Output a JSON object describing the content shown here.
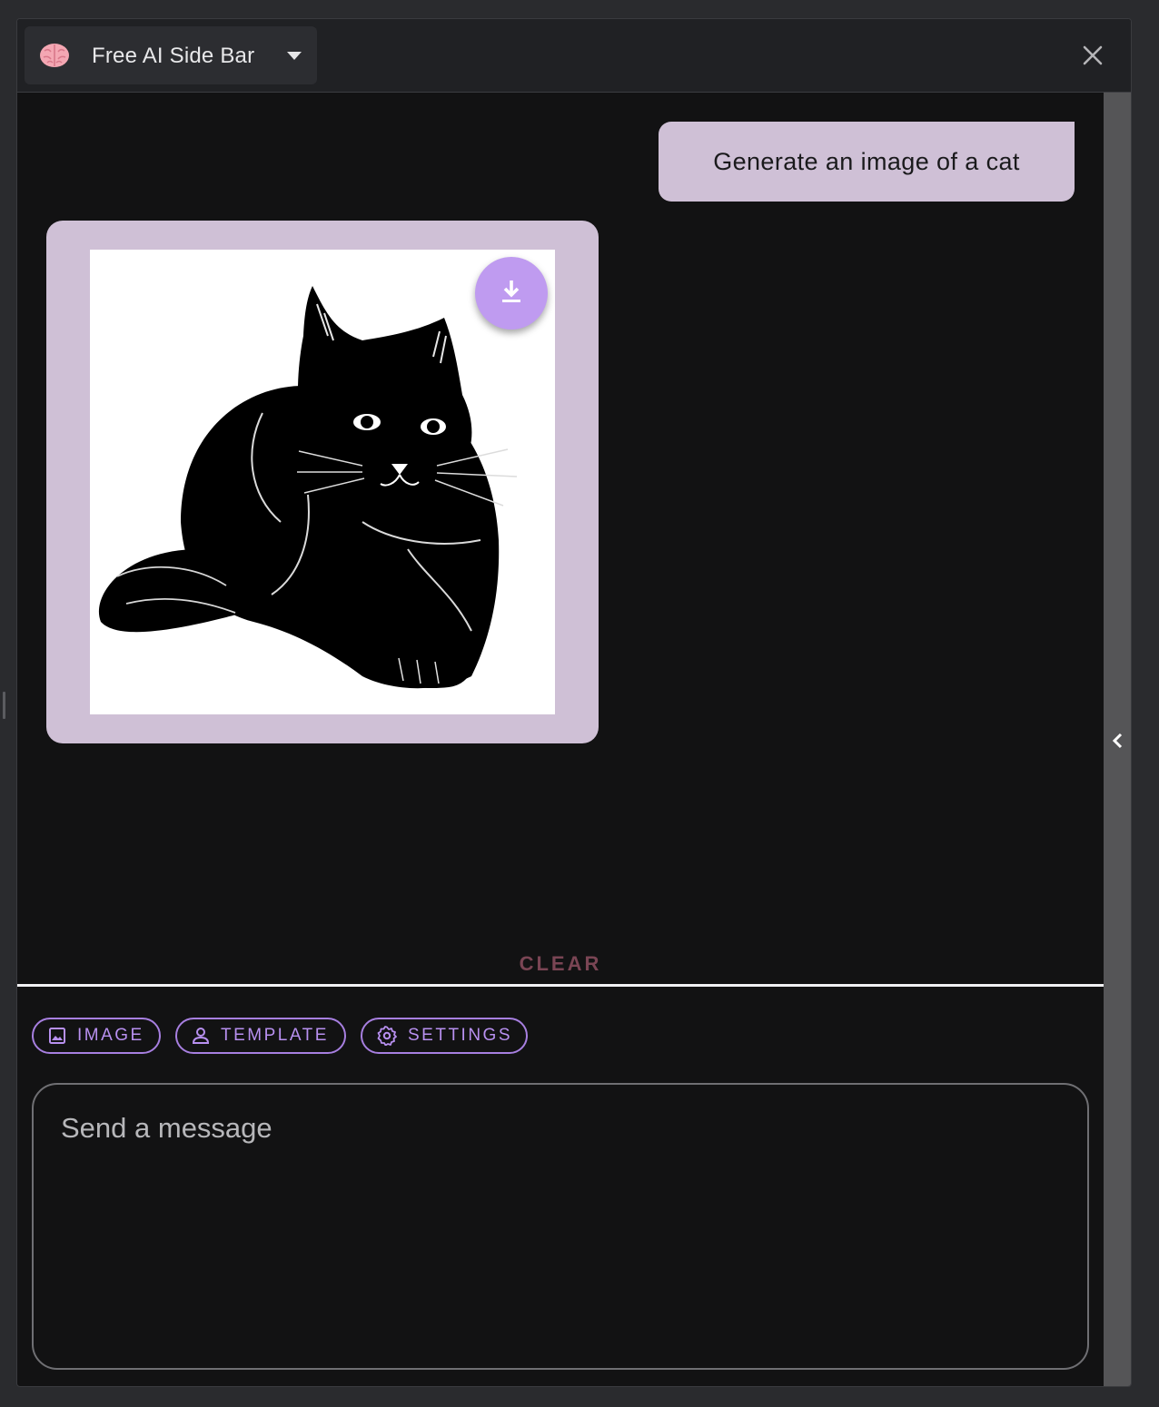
{
  "header": {
    "app_selector_label": "Free AI Side Bar",
    "brain_icon": "brain-icon",
    "caret_icon": "caret-down-icon",
    "close_icon": "close-icon"
  },
  "chat": {
    "messages": [
      {
        "role": "user",
        "text": "Generate an image of a cat"
      },
      {
        "role": "assistant",
        "content": "generated-image",
        "image_subject": "cat"
      }
    ],
    "download_icon": "download-icon",
    "clear_label": "CLEAR"
  },
  "tools": {
    "image_label": "IMAGE",
    "template_label": "TEMPLATE",
    "settings_label": "SETTINGS"
  },
  "input": {
    "placeholder": "Send a message",
    "value": ""
  },
  "colors": {
    "bubble": "#cfc0d6",
    "accent": "#b890f0",
    "download_button": "#bf9bf0",
    "clear": "#7a4554",
    "background": "#121213"
  }
}
